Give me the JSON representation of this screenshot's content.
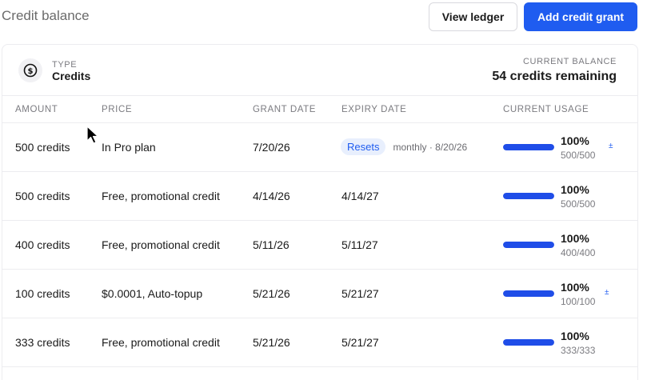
{
  "header": {
    "title": "Credit balance",
    "view_ledger": "View ledger",
    "add_credit_grant": "Add credit grant"
  },
  "summary": {
    "type_label": "TYPE",
    "type_value": "Credits",
    "balance_label": "CURRENT BALANCE",
    "balance_value": "54 credits remaining",
    "type_icon": "dollar-circle-icon"
  },
  "table": {
    "columns": [
      "AMOUNT",
      "PRICE",
      "GRANT DATE",
      "EXPIRY DATE",
      "CURRENT USAGE"
    ],
    "rows": [
      {
        "amount": "500 credits",
        "price": "In Pro plan",
        "grant_date": "7/20/26",
        "expiry": "",
        "resets": "Resets",
        "resets_detail": "monthly · 8/20/26",
        "usage_pct": "100%",
        "usage_ratio": "500/500",
        "usage_fraction": 1.0,
        "action_icon": "±"
      },
      {
        "amount": "500 credits",
        "price": "Free, promotional credit",
        "grant_date": "4/14/26",
        "expiry": "4/14/27",
        "resets": "",
        "resets_detail": "",
        "usage_pct": "100%",
        "usage_ratio": "500/500",
        "usage_fraction": 1.0,
        "action_icon": ""
      },
      {
        "amount": "400 credits",
        "price": "Free, promotional credit",
        "grant_date": "5/11/26",
        "expiry": "5/11/27",
        "resets": "",
        "resets_detail": "",
        "usage_pct": "100%",
        "usage_ratio": "400/400",
        "usage_fraction": 1.0,
        "action_icon": ""
      },
      {
        "amount": "100 credits",
        "price": "$0.0001, Auto-topup",
        "grant_date": "5/21/26",
        "expiry": "5/21/27",
        "resets": "",
        "resets_detail": "",
        "usage_pct": "100%",
        "usage_ratio": "100/100",
        "usage_fraction": 1.0,
        "action_icon": "±"
      },
      {
        "amount": "333 credits",
        "price": "Free, promotional credit",
        "grant_date": "5/21/26",
        "expiry": "5/21/27",
        "resets": "",
        "resets_detail": "",
        "usage_pct": "100%",
        "usage_ratio": "333/333",
        "usage_fraction": 1.0,
        "action_icon": ""
      }
    ]
  },
  "colors": {
    "accent": "#1f5cf0",
    "bar_fill": "#1f4de8",
    "pill_bg": "#e8effd"
  }
}
